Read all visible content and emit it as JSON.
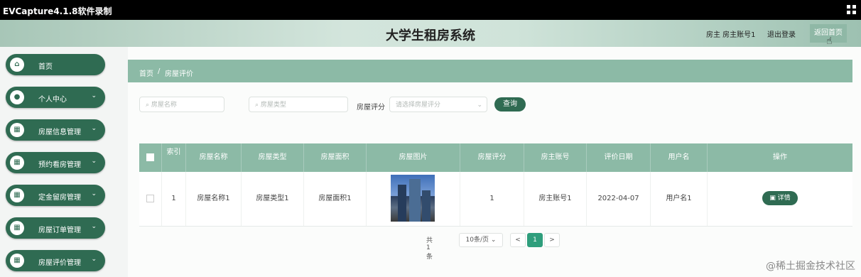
{
  "recorder": {
    "title": "EVCapture4.1.8软件录制",
    "icon": "grid-icon"
  },
  "header": {
    "title": "大学生租房系统",
    "role_text": "房主 房主账号1",
    "logout_text": "退出登录",
    "home_btn": "返回首页"
  },
  "sidebar": {
    "items": [
      {
        "label": "首页",
        "icon": "home-icon",
        "chevron": ""
      },
      {
        "label": "个人中心",
        "icon": "user-icon",
        "chevron": "⌄"
      },
      {
        "label": "房屋信息管理",
        "icon": "grid-icon",
        "chevron": "⌄"
      },
      {
        "label": "预约看房管理",
        "icon": "grid-icon",
        "chevron": "⌄"
      },
      {
        "label": "定金留房管理",
        "icon": "grid-icon",
        "chevron": "⌄"
      },
      {
        "label": "房屋订单管理",
        "icon": "grid-icon",
        "chevron": "⌄"
      },
      {
        "label": "房屋评价管理",
        "icon": "grid-icon",
        "chevron": "⌄"
      }
    ]
  },
  "breadcrumb": {
    "home": "首页",
    "separator": "/",
    "current": "房屋评价"
  },
  "search": {
    "name_placeholder": "房屋名称",
    "type_placeholder": "房屋类型",
    "score_label": "房屋评分",
    "score_placeholder": "请选择房屋评分",
    "button": "查询"
  },
  "table": {
    "headers": [
      "索引",
      "房屋名称",
      "房屋类型",
      "房屋面积",
      "房屋图片",
      "房屋评分",
      "房主账号",
      "评价日期",
      "用户名",
      "操作"
    ],
    "rows": [
      {
        "index": "1",
        "name": "房屋名称1",
        "type": "房屋类型1",
        "area": "房屋面积1",
        "score": "1",
        "owner": "房主账号1",
        "date": "2022-04-07",
        "user": "用户名1",
        "action": "▣ 详情"
      }
    ]
  },
  "pagination": {
    "total": "共 1 条",
    "page_size": "10条/页",
    "prev": "<",
    "current_page": "1",
    "next": ">"
  },
  "watermark": "@稀土掘金技术社区",
  "colors": {
    "primary": "#2f6b52",
    "header_teal": "#8cbaa6",
    "pager_active": "#2f9e7c"
  }
}
